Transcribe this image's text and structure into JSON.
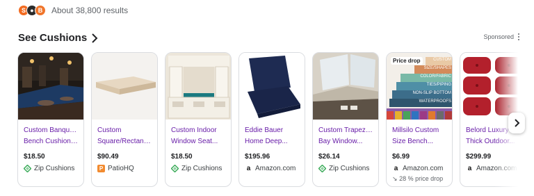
{
  "results_bar": {
    "favicons": [
      "orange-s-favicon",
      "dark-circle-favicon",
      "orange-b-favicon"
    ],
    "count": "About 38,800 results"
  },
  "section": {
    "title": "See Cushions",
    "sponsored_label": "Sponsored"
  },
  "colors": {
    "title_link": "#681da8",
    "zip_icon": "#34a853",
    "patio_icon": "#f28b30"
  },
  "products": [
    {
      "title_lines": [
        "Custom Banquette",
        "Bench Cushions..."
      ],
      "price": "$18.50",
      "merchant": "Zip Cushions",
      "merchant_icon": "zip-cushions-icon"
    },
    {
      "title_lines": [
        "Custom",
        "Square/Rectang..."
      ],
      "price": "$90.49",
      "merchant": "PatioHQ",
      "merchant_icon": "patiohq-icon"
    },
    {
      "title_lines": [
        "Custom Indoor",
        "Window Seat..."
      ],
      "price": "$18.50",
      "merchant": "Zip Cushions",
      "merchant_icon": "zip-cushions-icon"
    },
    {
      "title_lines": [
        "Eddie Bauer",
        "Home Deep..."
      ],
      "price": "$195.96",
      "merchant": "Amazon.com",
      "merchant_icon": "amazon-icon"
    },
    {
      "title_lines": [
        "Custom Trapezoid",
        "Bay Window..."
      ],
      "price": "$26.14",
      "merchant": "Zip Cushions",
      "merchant_icon": "zip-cushions-icon"
    },
    {
      "title_lines": [
        "Millsilo Custom",
        "Size Bench..."
      ],
      "price": "$6.99",
      "merchant": "Amazon.com",
      "merchant_icon": "amazon-icon",
      "badge": "Price drop",
      "price_drop_note": "28 % price drop",
      "banner_lines": [
        "CUSTOM",
        "SIZE/SHAPES",
        "COLOR/FABRIC",
        "TIES/PIPING",
        "NON-SLIP BOTTOM",
        "WATERPROOFS"
      ]
    },
    {
      "title_lines": [
        "Belord Luxury",
        "Thick Outdoor..."
      ],
      "price": "$299.99",
      "merchant": "Amazon.com",
      "merchant_icon": "amazon-icon"
    }
  ]
}
